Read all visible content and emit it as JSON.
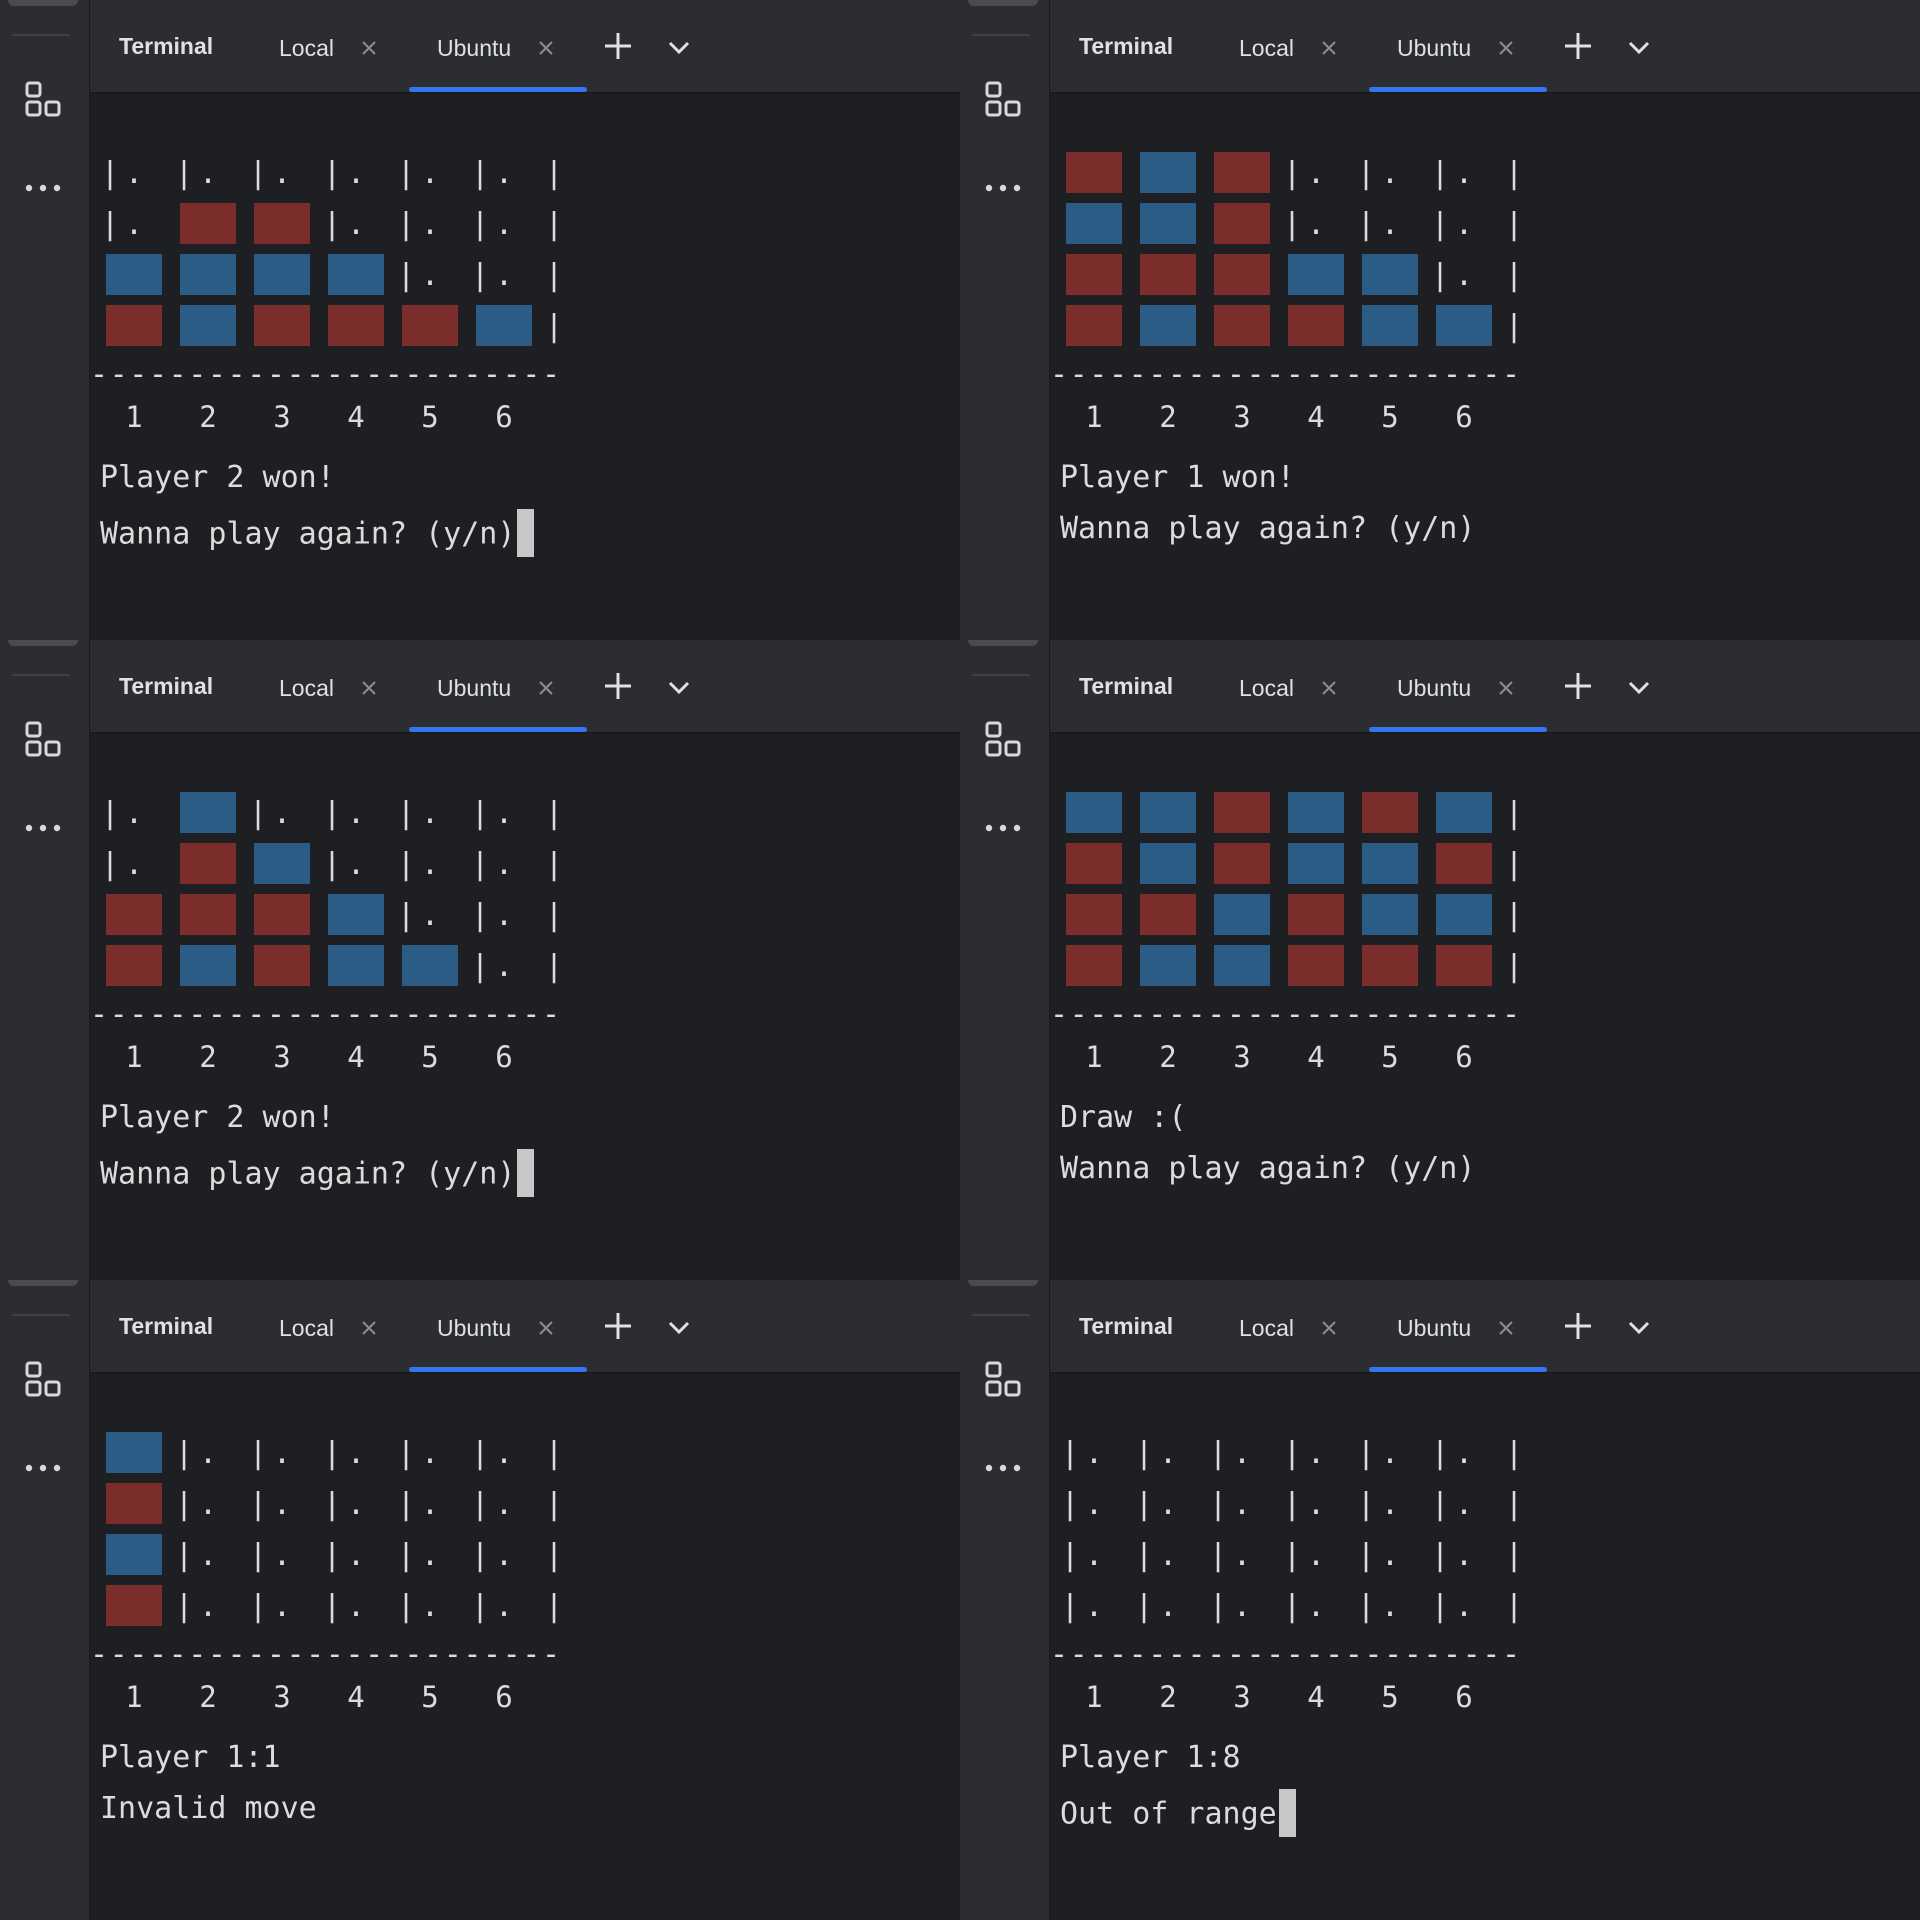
{
  "colors": {
    "player1": "#7b2d2b",
    "player2": "#2b5c85",
    "accent": "#3574f0"
  },
  "tabbar": {
    "title": "Terminal",
    "tabs": [
      "Local",
      "Ubuntu"
    ],
    "active_tab": "Ubuntu",
    "icons": [
      "close-icon",
      "plus-icon",
      "chevron-down-icon"
    ]
  },
  "rail": {
    "icons": [
      "structure-icon",
      "more-icon"
    ]
  },
  "column_numbers": [
    "1",
    "2",
    "3",
    "4",
    "5",
    "6"
  ],
  "separator": "------------------------",
  "empty_cell": ".",
  "panels": [
    {
      "board": [
        ".......",
        "......",
        ".RR...",
        "BBBB..",
        "RBRRRB"
      ],
      "status": "Player 2 won!",
      "prompt": "Wanna play again? (y/n)",
      "cursor": true
    },
    {
      "board": [
        "RBR...",
        "BBR...",
        "RRRBB.",
        "RBRRBB"
      ],
      "status": "Player 1 won!",
      "prompt": "Wanna play again? (y/n)",
      "cursor": false
    },
    {
      "board": [
        ".B....",
        ".RB...",
        "RRRB..",
        "RBRBB."
      ],
      "status": "Player 2 won!",
      "prompt": "Wanna play again? (y/n)",
      "cursor": true
    },
    {
      "board": [
        "BBRBRB",
        "RBRBBR",
        "RRBRBB",
        "RBBRRR"
      ],
      "status": "Draw :(",
      "prompt": "Wanna play again? (y/n)",
      "cursor": false
    },
    {
      "board": [
        "B.....",
        "R.....",
        "B.....",
        "R....."
      ],
      "status": "Player 1:1",
      "prompt": "Invalid move",
      "cursor": false
    },
    {
      "board": [
        "......",
        "......",
        "......",
        "......"
      ],
      "status": "Player 1:8",
      "prompt": "Out of range",
      "cursor": true
    }
  ]
}
